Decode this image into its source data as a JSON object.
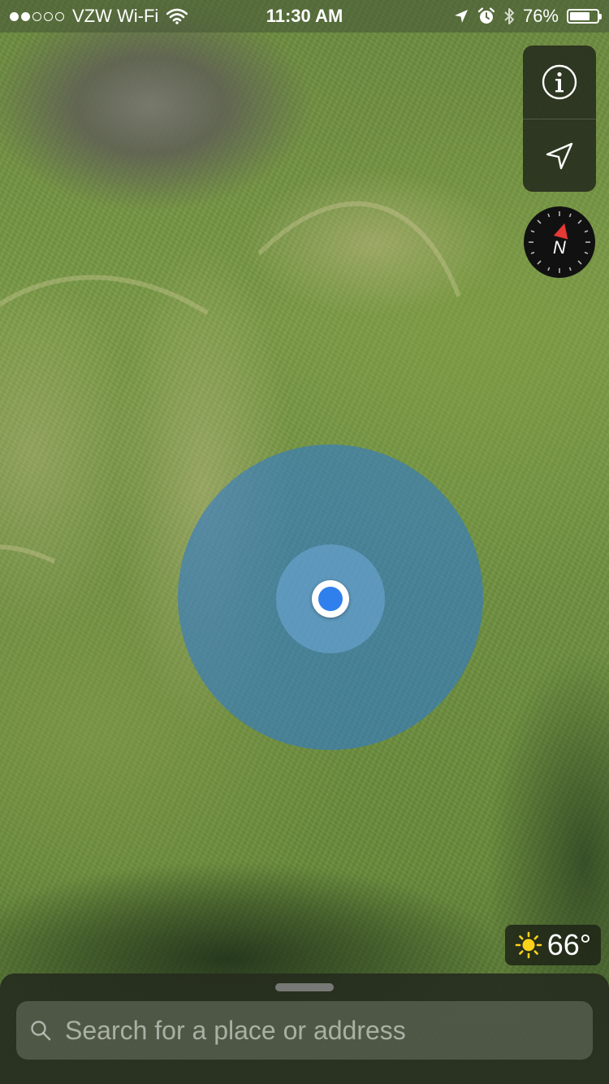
{
  "status_bar": {
    "carrier": "VZW Wi-Fi",
    "signal_bars_filled": 2,
    "signal_bars_total": 5,
    "time": "11:30 AM",
    "battery_percent": "76%",
    "battery_level": 0.76,
    "icons": [
      "wifi-icon",
      "location-arrow-icon",
      "alarm-icon",
      "bluetooth-icon",
      "battery-icon"
    ]
  },
  "map_controls": {
    "info_icon": "info-icon",
    "tracking_icon": "location-arrow-icon",
    "compass_label": "N",
    "compass_needle_color": "#e53935"
  },
  "user_location": {
    "dot_color": "#2f80ed"
  },
  "weather": {
    "icon": "sun-icon",
    "temperature": "66°",
    "icon_color": "#ffd21a"
  },
  "search": {
    "placeholder": "Search for a place or address",
    "value": ""
  }
}
